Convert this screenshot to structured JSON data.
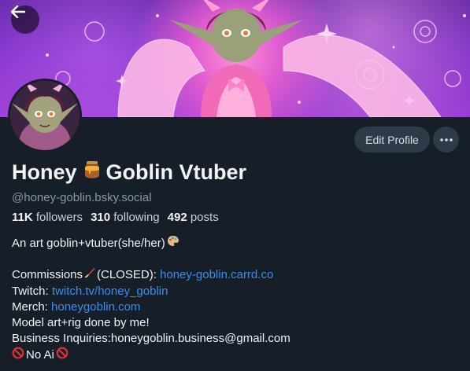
{
  "header": {
    "back_icon": "arrow-left-icon"
  },
  "profile": {
    "display_name_part1": "Honey",
    "display_name_icon": "honey-pot-icon",
    "display_name_part2": "Goblin Vtuber",
    "handle": "@honey-goblin.bsky.social",
    "followers_count": "11K",
    "followers_label": "followers",
    "following_count": "310",
    "following_label": "following",
    "posts_count": "492",
    "posts_label": "posts"
  },
  "actions": {
    "edit_profile_label": "Edit Profile",
    "more_icon": "ellipsis-icon"
  },
  "bio": {
    "line1": "An art goblin+vtuber(she/her)",
    "line1_icon": "palette-icon",
    "commissions_prefix": "Commissions",
    "commissions_icon": "paintbrush-icon",
    "commissions_status": "(CLOSED):",
    "commissions_link": "honey-goblin.carrd.co",
    "twitch_label": "Twitch:",
    "twitch_link": "twitch.tv/honey_goblin",
    "merch_label": "Merch:",
    "merch_link": "honeygoblin.com",
    "model_line": "Model art+rig done by me!",
    "business_line": "Business Inquiries:honeygoblin.business@gmail.com",
    "no_ai_text": "No Ai",
    "no_ai_icon": "prohibited-icon"
  },
  "colors": {
    "background": "#161e27",
    "link": "#3a8ef0",
    "button_bg": "#2e3a48",
    "muted_text": "#8a97a6"
  }
}
